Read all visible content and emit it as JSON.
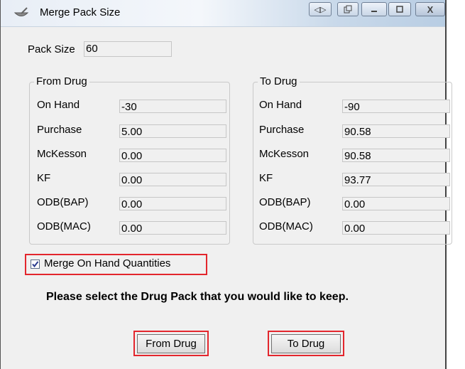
{
  "window": {
    "title": "Merge Pack Size",
    "icons": [
      "mortar-pestle-icon",
      "nav-arrows-icon",
      "restore-icon",
      "minimize-icon",
      "maximize-icon",
      "close-icon"
    ],
    "close_glyph": "X"
  },
  "pack_size": {
    "label": "Pack Size",
    "value": "60"
  },
  "from_drug": {
    "title": "From Drug",
    "rows": [
      {
        "label": "On Hand",
        "value": "-30"
      },
      {
        "label": "Purchase",
        "value": "5.00"
      },
      {
        "label": "McKesson",
        "value": "0.00"
      },
      {
        "label": "KF",
        "value": "0.00"
      },
      {
        "label": "ODB(BAP)",
        "value": "0.00"
      },
      {
        "label": "ODB(MAC)",
        "value": "0.00"
      }
    ]
  },
  "to_drug": {
    "title": "To Drug",
    "rows": [
      {
        "label": "On Hand",
        "value": "-90"
      },
      {
        "label": "Purchase",
        "value": "90.58"
      },
      {
        "label": "McKesson",
        "value": "90.58"
      },
      {
        "label": "KF",
        "value": "93.77"
      },
      {
        "label": "ODB(BAP)",
        "value": "0.00"
      },
      {
        "label": "ODB(MAC)",
        "value": "0.00"
      }
    ]
  },
  "merge_checkbox": {
    "label": "Merge On Hand Quantities",
    "checked": true
  },
  "prompt": "Please select the Drug Pack that you would like to keep.",
  "buttons": {
    "from_drug": "From Drug",
    "to_drug": "To Drug"
  },
  "colors": {
    "highlight": "#e3262d",
    "field_bg": "#f0f0f0",
    "dialog_bg": "#f0f0f0"
  }
}
